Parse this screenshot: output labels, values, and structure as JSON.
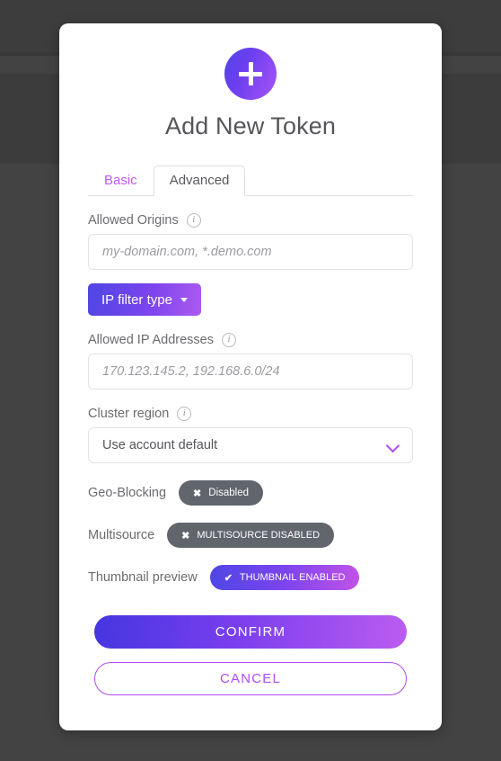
{
  "modal": {
    "icon_name": "plus-icon",
    "title": "Add New Token",
    "tabs": [
      {
        "label": "Basic",
        "active": false
      },
      {
        "label": "Advanced",
        "active": true
      }
    ],
    "fields": {
      "allowed_origins": {
        "label": "Allowed Origins",
        "info_glyph": "i",
        "placeholder": "my-domain.com, *.demo.com",
        "value": ""
      },
      "ip_filter_type": {
        "label": "IP filter type",
        "caret": "caret-down-icon"
      },
      "allowed_ip_addresses": {
        "label": "Allowed IP Addresses",
        "info_glyph": "i",
        "placeholder": "170.123.145.2, 192.168.6.0/24",
        "value": ""
      },
      "cluster_region": {
        "label": "Cluster region",
        "info_glyph": "i",
        "selected": "Use account default"
      }
    },
    "toggles": [
      {
        "label": "Geo-Blocking",
        "pill_label": "Disabled",
        "pill_glyph": "✖",
        "state": "off"
      },
      {
        "label": "Multisource",
        "pill_label": "MULTISOURCE DISABLED",
        "pill_glyph": "✖",
        "state": "off"
      },
      {
        "label": "Thumbnail preview",
        "pill_label": "THUMBNAIL ENABLED",
        "pill_glyph": "✔",
        "state": "on"
      }
    ],
    "actions": {
      "confirm": "CONFIRM",
      "cancel": "CANCEL"
    }
  },
  "colors": {
    "accent_purple": "#b14cf0",
    "gradient_start": "#4f46e5",
    "gradient_end": "#bb5cf0",
    "pill_off": "#61656c",
    "overlay": "#3e3e3e",
    "label_text": "#6b6c6f"
  }
}
